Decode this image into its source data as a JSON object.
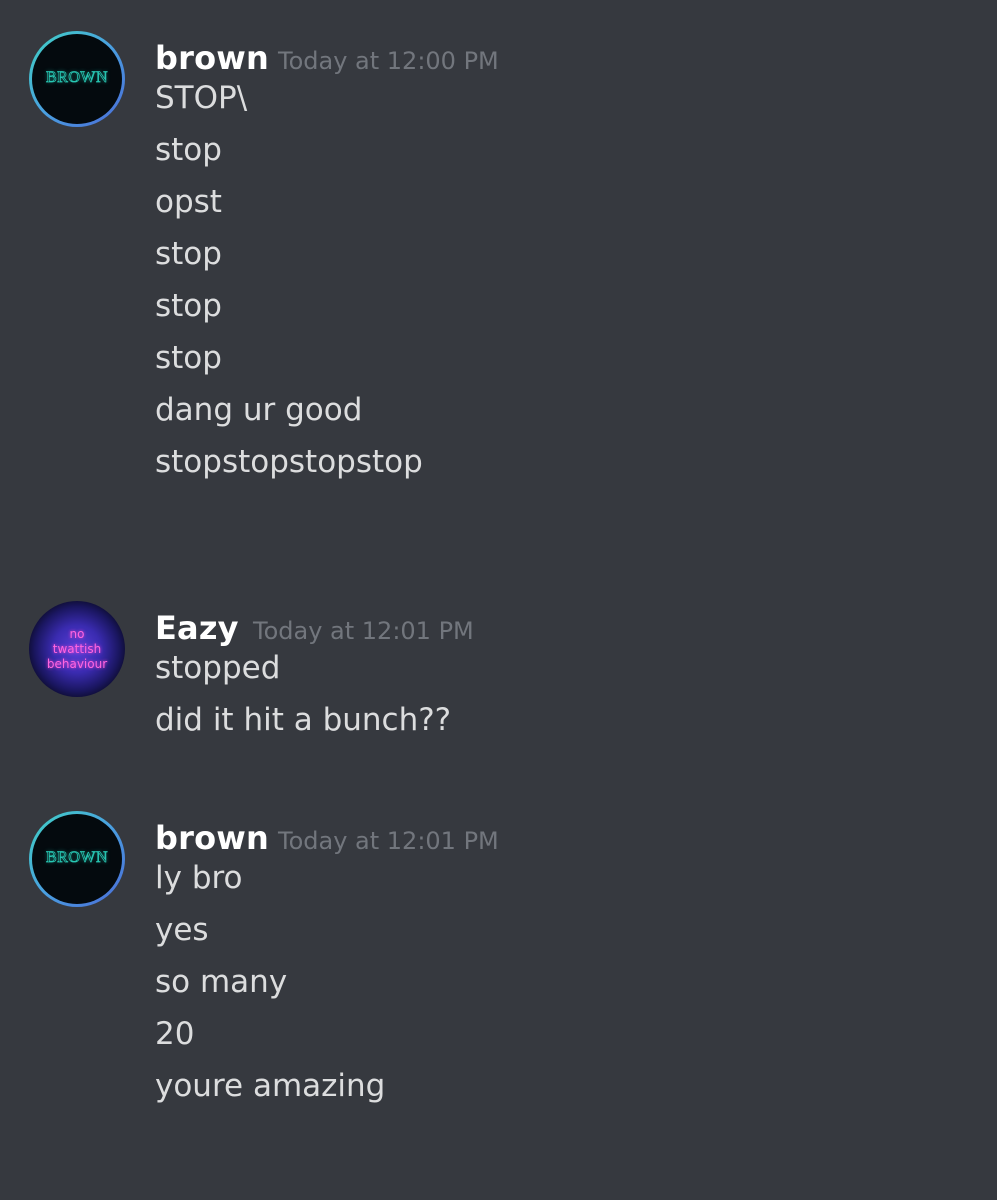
{
  "messages": [
    {
      "username": "brown",
      "timestamp": "Today at 12:00 PM",
      "avatar_text": "BROWN",
      "lines": [
        "STOP\\",
        "stop",
        "opst",
        "stop",
        "stop",
        "stop",
        "dang ur good",
        "stopstopstopstop"
      ]
    },
    {
      "username": "Eazy",
      "timestamp": "Today at 12:01 PM",
      "avatar_text": [
        "no",
        "twattish",
        "behaviour"
      ],
      "lines": [
        "stopped",
        "did it hit a bunch??"
      ]
    },
    {
      "username": "brown",
      "timestamp": "Today at 12:01 PM",
      "avatar_text": "BROWN",
      "lines": [
        "ly bro",
        "yes",
        "so many",
        "20",
        "youre amazing"
      ]
    }
  ],
  "colors": {
    "background": "#36393f",
    "username": "#ffffff",
    "timestamp": "#72767d",
    "message_text": "#dcddde"
  }
}
